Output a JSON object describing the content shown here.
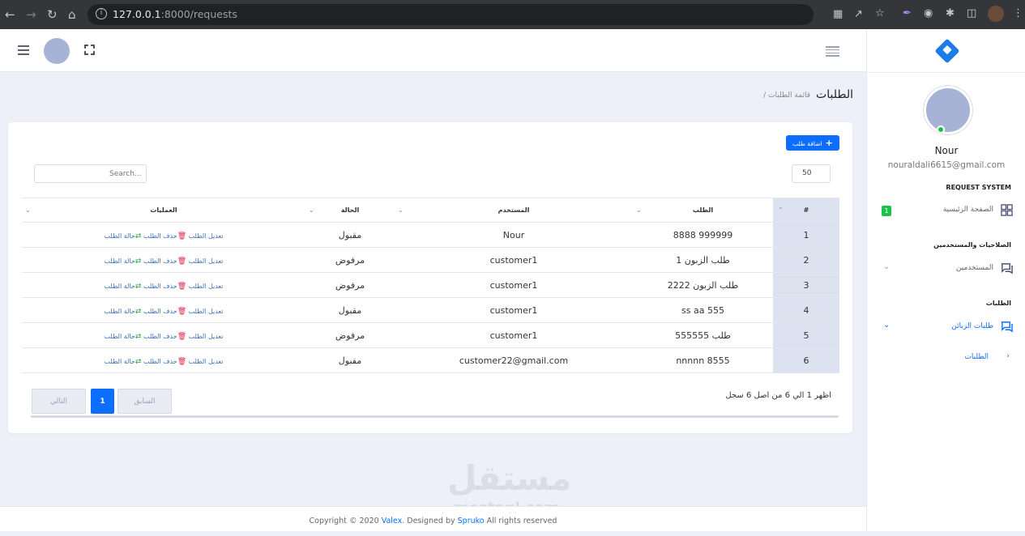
{
  "browser": {
    "url_host": "127.0.0.1",
    "url_rest": ":8000/requests"
  },
  "page": {
    "title": "الطلبات",
    "breadcrumb": "/ قائمة الطلبات"
  },
  "toolbar": {
    "add_label": "اضافة طلب",
    "page_size": "50",
    "search_placeholder": "Search..."
  },
  "table": {
    "headers": [
      "#",
      "الطلب",
      "المستخدم",
      "الحالة",
      "العمليات"
    ],
    "rows": [
      {
        "num": "1",
        "request": "8888 999999",
        "user": "Nour",
        "status": "مقبول"
      },
      {
        "num": "2",
        "request": "طلب الزبون 1",
        "user": "customer1",
        "status": "مرفوض"
      },
      {
        "num": "3",
        "request": "طلب الزبون 2222",
        "user": "customer1",
        "status": "مرفوض"
      },
      {
        "num": "4",
        "request": "ss aa 555",
        "user": "customer1",
        "status": "مقبول"
      },
      {
        "num": "5",
        "request": "طلب 555555",
        "user": "customer1",
        "status": "مرفوض"
      },
      {
        "num": "6",
        "request": "nnnnn 8555",
        "user": "customer22@gmail.com",
        "status": "مقبول"
      }
    ],
    "ops": {
      "edit": "تعديل الطلب",
      "delete": "حذف الطلب",
      "status": "حالة الطلب"
    }
  },
  "pagination": {
    "info": "اظهر 1 الي 6 من اصل 6 سجل",
    "prev": "السابق",
    "current": "1",
    "next": "التالي"
  },
  "sidebar": {
    "user_name": "Nour",
    "user_email": "nouraldali6615@gmail.com",
    "section_system": "REQUEST SYSTEM",
    "home": "الصفحة الرئيسية",
    "home_badge": "1",
    "section_perms": "الصلاحيات والمستخدمين",
    "users": "المستخدمين",
    "section_requests": "الطلبات",
    "customer_requests": "طلبات الزبائن",
    "requests": "الطلبات"
  },
  "footer": {
    "pre": "Copyright © 2020 ",
    "brand": "Valex",
    "mid": ". Designed by ",
    "designer": "Spruko",
    "post": " All rights reserved"
  },
  "watermark": {
    "arabic": "مستقل",
    "latin": "mostaql.com"
  },
  "colors": {
    "accent": "#0d6efd",
    "success": "#1fbf4c",
    "status": "#e29a00",
    "danger": "#e0264b"
  }
}
